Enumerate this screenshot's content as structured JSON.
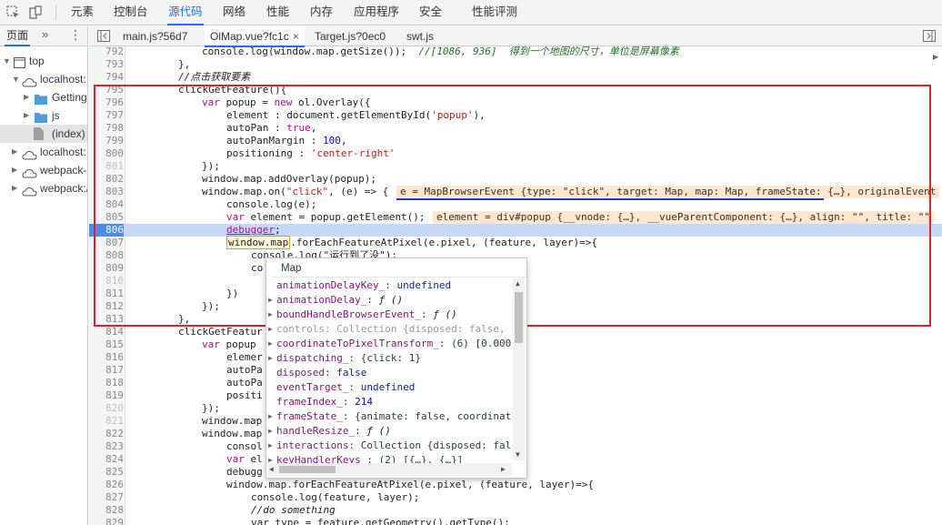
{
  "top_tabs": [
    {
      "label": "元素"
    },
    {
      "label": "控制台"
    },
    {
      "label": "源代码"
    },
    {
      "label": "网络"
    },
    {
      "label": "性能"
    },
    {
      "label": "内存"
    },
    {
      "label": "应用程序"
    },
    {
      "label": "安全"
    },
    {
      "label": "性能评测"
    }
  ],
  "left_pane": {
    "tab_label": "页面",
    "more": "»",
    "menu": "⋮",
    "tree": [
      {
        "label": "top",
        "icon": "frame-icon"
      },
      {
        "label": "localhost:",
        "icon": "cloud-icon"
      },
      {
        "label": "Getting",
        "icon": "folder-icon"
      },
      {
        "label": "js",
        "icon": "folder-icon"
      },
      {
        "label": "(index)",
        "icon": "file-icon"
      },
      {
        "label": "localhost:",
        "icon": "cloud-icon"
      },
      {
        "label": "webpack-",
        "icon": "cloud-icon"
      },
      {
        "label": "webpack:/",
        "icon": "cloud-icon"
      }
    ]
  },
  "editor_tabs": [
    {
      "label": "main.js?56d7"
    },
    {
      "label": "OlMap.vue?fc1c",
      "close": "×"
    },
    {
      "label": "Target.js?0ec0"
    },
    {
      "label": "swt.js"
    }
  ],
  "code": {
    "line_numbers": [
      "792",
      "793",
      "794",
      "795",
      "796",
      "797",
      "798",
      "799",
      "800",
      "801",
      "802",
      "803",
      "804",
      "805",
      "806",
      "807",
      "808",
      "809",
      "810",
      "811",
      "812",
      "813",
      "814",
      "815",
      "816",
      "817",
      "818",
      "819",
      "820",
      "821",
      "822",
      "823",
      "824",
      "825",
      "826",
      "827",
      "828",
      "829"
    ],
    "l792": "console.log(window.map.getSize());  ",
    "l792_comment": "//[1086, 936]  得到一个地图的尺寸，单位是屏幕像素",
    "l793": "},",
    "l794_comment": "//点击获取要素",
    "l795": "clickGetFeature(){",
    "l796a": "var",
    "l796b": " popup = ",
    "l796c": "new",
    "l796d": " ol.Overlay({",
    "l797a": "element : document.getElementById(",
    "l797b": "'popup'",
    "l797c": "),",
    "l798a": "autoPan : ",
    "l798b": "true",
    "l798c": ",",
    "l799a": "autoPanMargin : ",
    "l799b": "100",
    "l799c": ",",
    "l800a": "positioning : ",
    "l800b": "'center-right'",
    "l802": "});",
    "l803": "window.map.addOverlay(popup);",
    "l804a": "window.map.on(",
    "l804b": "\"click\"",
    "l804c": ", (e) => {",
    "l805": "console.log(e);",
    "l806a": "var",
    "l806b": " element = popup.getElement();",
    "l806_debugger": "debugger",
    "l806_semi": ";",
    "l807a": "window.map",
    "l807b": ".forEachFeatureAtPixel(e.pixel, (feature, layer)=>{",
    "l808a": "con",
    "l808b": "sole.log(\"运行到了没\");",
    "l809": "co",
    "l811": "})",
    "l812": "});",
    "l813": "},",
    "l814": "clickGetFeatur",
    "l815a": "var",
    "l815b": " popup",
    "l816": "elemer",
    "l817": "autoPa",
    "l818": "autoPa",
    "l819": "positi",
    "l820": "});",
    "l822": "window.map",
    "l823": "window.map",
    "l824": "consol",
    "l825a": "var",
    "l825b": " el",
    "l826": "debugg",
    "l827": "window.map.forEachFeatureAtPixel(e.pixel, (feature, layer)=>{",
    "l828": "console.log(feature, layer);",
    "l829_comment": "//do something",
    "l830": "var type = feature.getGeometry().getType();"
  },
  "inline_values": {
    "e": "e = MapBrowserEvent {type: \"click\", target: Map, map: Map, frameState: {…}, originalEvent",
    "element": "element = div#popup {__vnode: {…}, __vueParentComponent: {…}, align: \"\", title: \"\""
  },
  "popover": {
    "title": "Map",
    "props": [
      {
        "expandable": false,
        "name": "animationDelayKey_",
        "value": "undefined",
        "vtype": "kw",
        "dim": false
      },
      {
        "expandable": true,
        "name": "animationDelay_",
        "value": "ƒ ()",
        "vtype": "fn",
        "dim": false
      },
      {
        "expandable": true,
        "name": "boundHandleBrowserEvent_",
        "value": "ƒ ()",
        "vtype": "fn",
        "dim": false
      },
      {
        "expandable": true,
        "name": "controls",
        "value": "Collection {disposed: false,",
        "vtype": "plain",
        "dim": true
      },
      {
        "expandable": true,
        "name": "coordinateToPixelTransform_",
        "value": "(6) [0.000",
        "vtype": "plain",
        "dim": false
      },
      {
        "expandable": true,
        "name": "dispatching_",
        "value": "{click: 1}",
        "vtype": "plain",
        "dim": false
      },
      {
        "expandable": false,
        "name": "disposed",
        "value": "false",
        "vtype": "kw",
        "dim": false
      },
      {
        "expandable": false,
        "name": "eventTarget_",
        "value": "undefined",
        "vtype": "kw",
        "dim": false
      },
      {
        "expandable": false,
        "name": "frameIndex_",
        "value": "214",
        "vtype": "num",
        "dim": false
      },
      {
        "expandable": true,
        "name": "frameState_",
        "value": "{animate: false, coordinat",
        "vtype": "plain",
        "dim": false
      },
      {
        "expandable": true,
        "name": "handleResize_",
        "value": "ƒ ()",
        "vtype": "fn",
        "dim": false
      },
      {
        "expandable": true,
        "name": "interactions",
        "value": "Collection {disposed: fal",
        "vtype": "plain",
        "dim": false
      },
      {
        "expandable": true,
        "name": "keyHandlerKeys_",
        "value": "(2) [{…}, {…}]",
        "vtype": "plain",
        "dim": false
      }
    ]
  },
  "colors": {
    "accent": "#1a73e8",
    "highlight_box": "#e0202b",
    "exec_line": "#c5d9f6",
    "inline_value_bg": "#ffe6cc"
  }
}
